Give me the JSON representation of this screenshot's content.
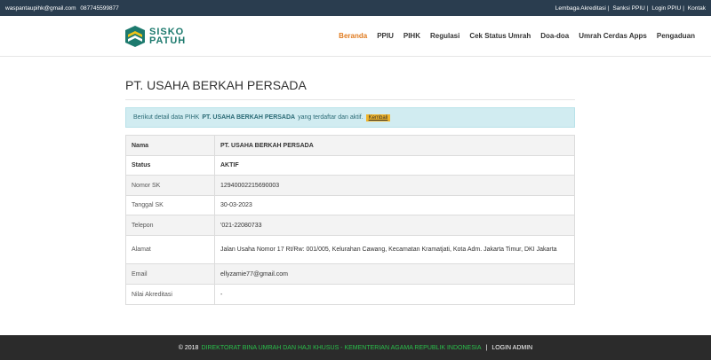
{
  "topbar": {
    "email": "waspantaupihk@gmail.com",
    "phone": "087745599877",
    "links": [
      "Lembaga Akreditasi",
      "Sanksi PPIU",
      "Login PPIU",
      "Kontak"
    ]
  },
  "logo": {
    "line1": "SISKO",
    "line2": "PATUH"
  },
  "nav": [
    "Beranda",
    "PPIU",
    "PIHK",
    "Regulasi",
    "Cek Status Umrah",
    "Doa-doa",
    "Umrah Cerdas Apps",
    "Pengaduan"
  ],
  "page": {
    "title": "PT. USAHA BERKAH PERSADA",
    "alert": {
      "prefix": "Berikut detail data PIHK",
      "name": "PT. USAHA BERKAH PERSADA",
      "suffix": "yang terdaftar dan aktif.",
      "back_label": "Kembali"
    },
    "rows": [
      {
        "label": "Nama",
        "value": "PT. USAHA BERKAH PERSADA"
      },
      {
        "label": "Status",
        "value": "AKTIF"
      },
      {
        "label": "Nomor SK",
        "value": "12940002215690003"
      },
      {
        "label": "Tanggal SK",
        "value": "30-03-2023"
      },
      {
        "label": "Telepon",
        "value": "'021-22080733"
      },
      {
        "label": "Alamat",
        "value": "Jalan Usaha Nomor 17 Rt/Rw: 001/005, Kelurahan Cawang, Kecamatan Kramatjati, Kota Adm. Jakarta Timur, DKI Jakarta"
      },
      {
        "label": "Email",
        "value": "ellyzamie77@gmail.com"
      },
      {
        "label": "Nilai Akreditasi",
        "value": "-"
      }
    ]
  },
  "footer": {
    "copyright": "© 2018",
    "org": "DIREKTORAT BINA UMRAH DAN HAJI KHUSUS - KEMENTERIAN AGAMA REPUBLIK INDONESIA",
    "login": "LOGIN ADMIN"
  },
  "colors": {
    "topbar": "#2a3d4f",
    "accent": "#e07b1f",
    "brand": "#1d7a6e",
    "footer_link": "#2bbf4b"
  }
}
